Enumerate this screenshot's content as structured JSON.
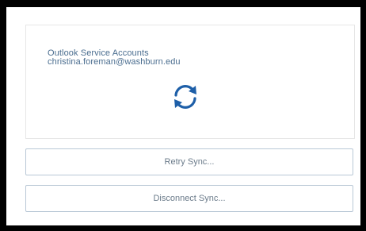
{
  "account": {
    "service_label": "Outlook Service Accounts",
    "email": "christina.foreman@washburn.edu",
    "status_icon": "sync-icon"
  },
  "actions": {
    "retry_label": "Retry Sync...",
    "disconnect_label": "Disconnect Sync..."
  },
  "colors": {
    "accent": "#1e5fa8",
    "text": "#4a6d8f",
    "border": "#b9c8d6"
  }
}
